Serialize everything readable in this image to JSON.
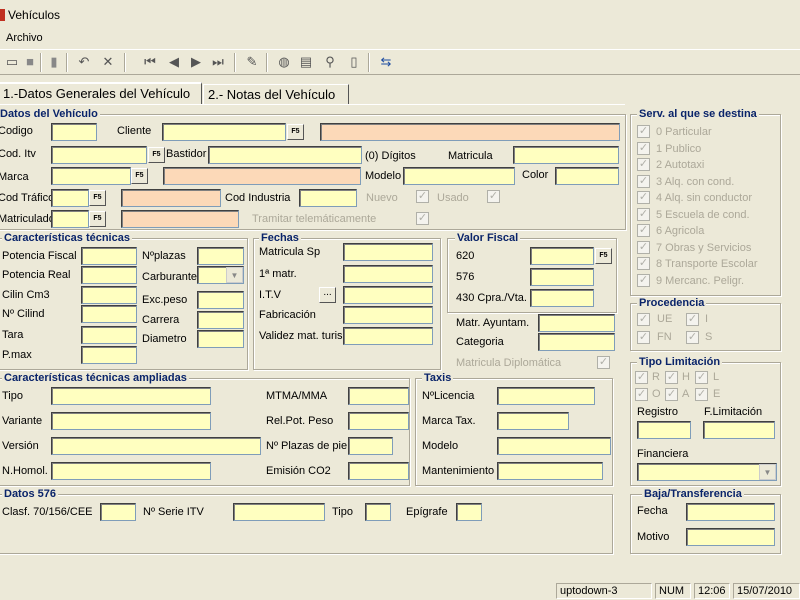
{
  "window": {
    "title": "Vehículos"
  },
  "menu": {
    "archivo": "Archivo"
  },
  "tabs": [
    {
      "label": "1.-Datos Generales del Vehículo"
    },
    {
      "label": "2.- Notas del Vehículo"
    }
  ],
  "datos_vehiculo": {
    "title": "Datos del Vehículo",
    "codigo": "Codigo",
    "cliente": "Cliente",
    "cod_itv": "Cod. Itv",
    "bastidor": "Bastidor",
    "digitos": "(0) Dígitos",
    "matricula": "Matricula",
    "marca": "Marca",
    "modelo": "Modelo",
    "color": "Color",
    "cod_trafico": "Cod Tráfico",
    "cod_industria": "Cod Industria",
    "nuevo": "Nuevo",
    "usado": "Usado",
    "matriculado": "Matriculado",
    "tramitar": "Tramitar telemáticamente",
    "f5": "F5"
  },
  "caract": {
    "title": "Características técnicas",
    "potencia_fiscal": "Potencia Fiscal",
    "potencia_real": "Potencia Real",
    "cilin": "Cilin Cm3",
    "n_cilind": "Nº Cilind",
    "tara": "Tara",
    "pmax": "P.max",
    "nplazas": "Nºplazas",
    "carburante": "Carburante",
    "exc_peso": "Exc.peso",
    "carrera": "Carrera",
    "diametro": "Diametro"
  },
  "fechas": {
    "title": "Fechas",
    "matricula_sp": "Matricula Sp",
    "primera_matr": "1ª matr.",
    "itv": "I.T.V",
    "fabricacion": "Fabricación",
    "validez": "Validez mat. turis"
  },
  "valor_fiscal": {
    "title": "Valor Fiscal",
    "v620": "620",
    "v576": "576",
    "v430": "430 Cpra./Vta."
  },
  "otros": {
    "matr_ayuntam": "Matr. Ayuntam.",
    "categoria": "Categoria",
    "matricula_diplomatica": "Matricula Diplomática"
  },
  "ampliadas": {
    "title": "Características técnicas ampliadas",
    "tipo": "Tipo",
    "variante": "Variante",
    "version": "Versión",
    "n_homol": "N.Homol.",
    "mtma": "MTMA/MMA",
    "rel_pot": "Rel.Pot. Peso",
    "n_plazas_pie": "Nº Plazas de pie",
    "emision": "Emisión CO2"
  },
  "taxis": {
    "title": "Taxis",
    "licencia": "NºLicencia",
    "marca_tax": "Marca Tax.",
    "modelo": "Modelo",
    "mantenimiento": "Mantenimiento"
  },
  "datos576": {
    "title": "Datos 576",
    "clasf": "Clasf. 70/156/CEE",
    "n_serie": "Nº Serie ITV",
    "tipo": "Tipo",
    "epigrafe": "Epígrafe"
  },
  "servicio": {
    "title": "Serv. al que se destina",
    "items": [
      "0 Particular",
      "1 Publico",
      "2 Autotaxi",
      "3 Alq. con cond.",
      "4 Alq. sin conductor",
      "5 Escuela de cond.",
      "6 Agricola",
      "7 Obras y Servicios",
      "8 Transporte Escolar",
      "9 Mercanc. Peligr."
    ]
  },
  "procedencia": {
    "title": "Procedencia",
    "ue": "UE",
    "i": "I",
    "fn": "FN",
    "s": "S"
  },
  "tipo_limitacion": {
    "title": "Tipo Limitación",
    "r": "R",
    "h": "H",
    "l": "L",
    "o": "O",
    "a": "A",
    "e": "E",
    "registro": "Registro",
    "f_limitacion": "F.Limitación",
    "financiera": "Financiera"
  },
  "baja": {
    "title": "Baja/Transferencia",
    "fecha": "Fecha",
    "motivo": "Motivo"
  },
  "status": {
    "user": "uptodown-3",
    "num": "NUM",
    "time": "12:06",
    "date": "15/07/2010"
  }
}
